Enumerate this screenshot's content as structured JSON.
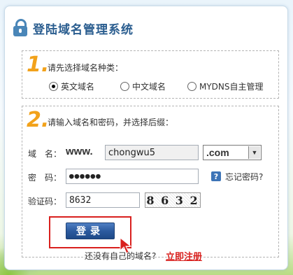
{
  "header": {
    "title": "登陆域名管理系统"
  },
  "step1": {
    "number": "1.",
    "label": "请先选择域名种类：",
    "options": [
      {
        "label": "英文域名",
        "selected": true
      },
      {
        "label": "中文域名",
        "selected": false
      },
      {
        "label": "MYDNS自主管理",
        "selected": false
      }
    ]
  },
  "step2": {
    "number": "2.",
    "label": "请输入域名和密码，并选择后缀：",
    "domain_label": "域　名：",
    "domain_prefix": "www.",
    "domain_value": "chongwu5",
    "suffix_value": ".com",
    "password_label": "密　码：",
    "password_value": "●●●●●●",
    "forgot_label": "忘记密码?",
    "captcha_label": "验证码：",
    "captcha_value": "8632",
    "captcha_image_text": "8 6 3 2",
    "login_label": "登录"
  },
  "footer": {
    "question": "还没有自己的域名?",
    "register_label": "立即注册"
  },
  "colors": {
    "accent": "#2a5d8f",
    "step_number": "#f2a21b",
    "highlight": "#d9201e"
  }
}
